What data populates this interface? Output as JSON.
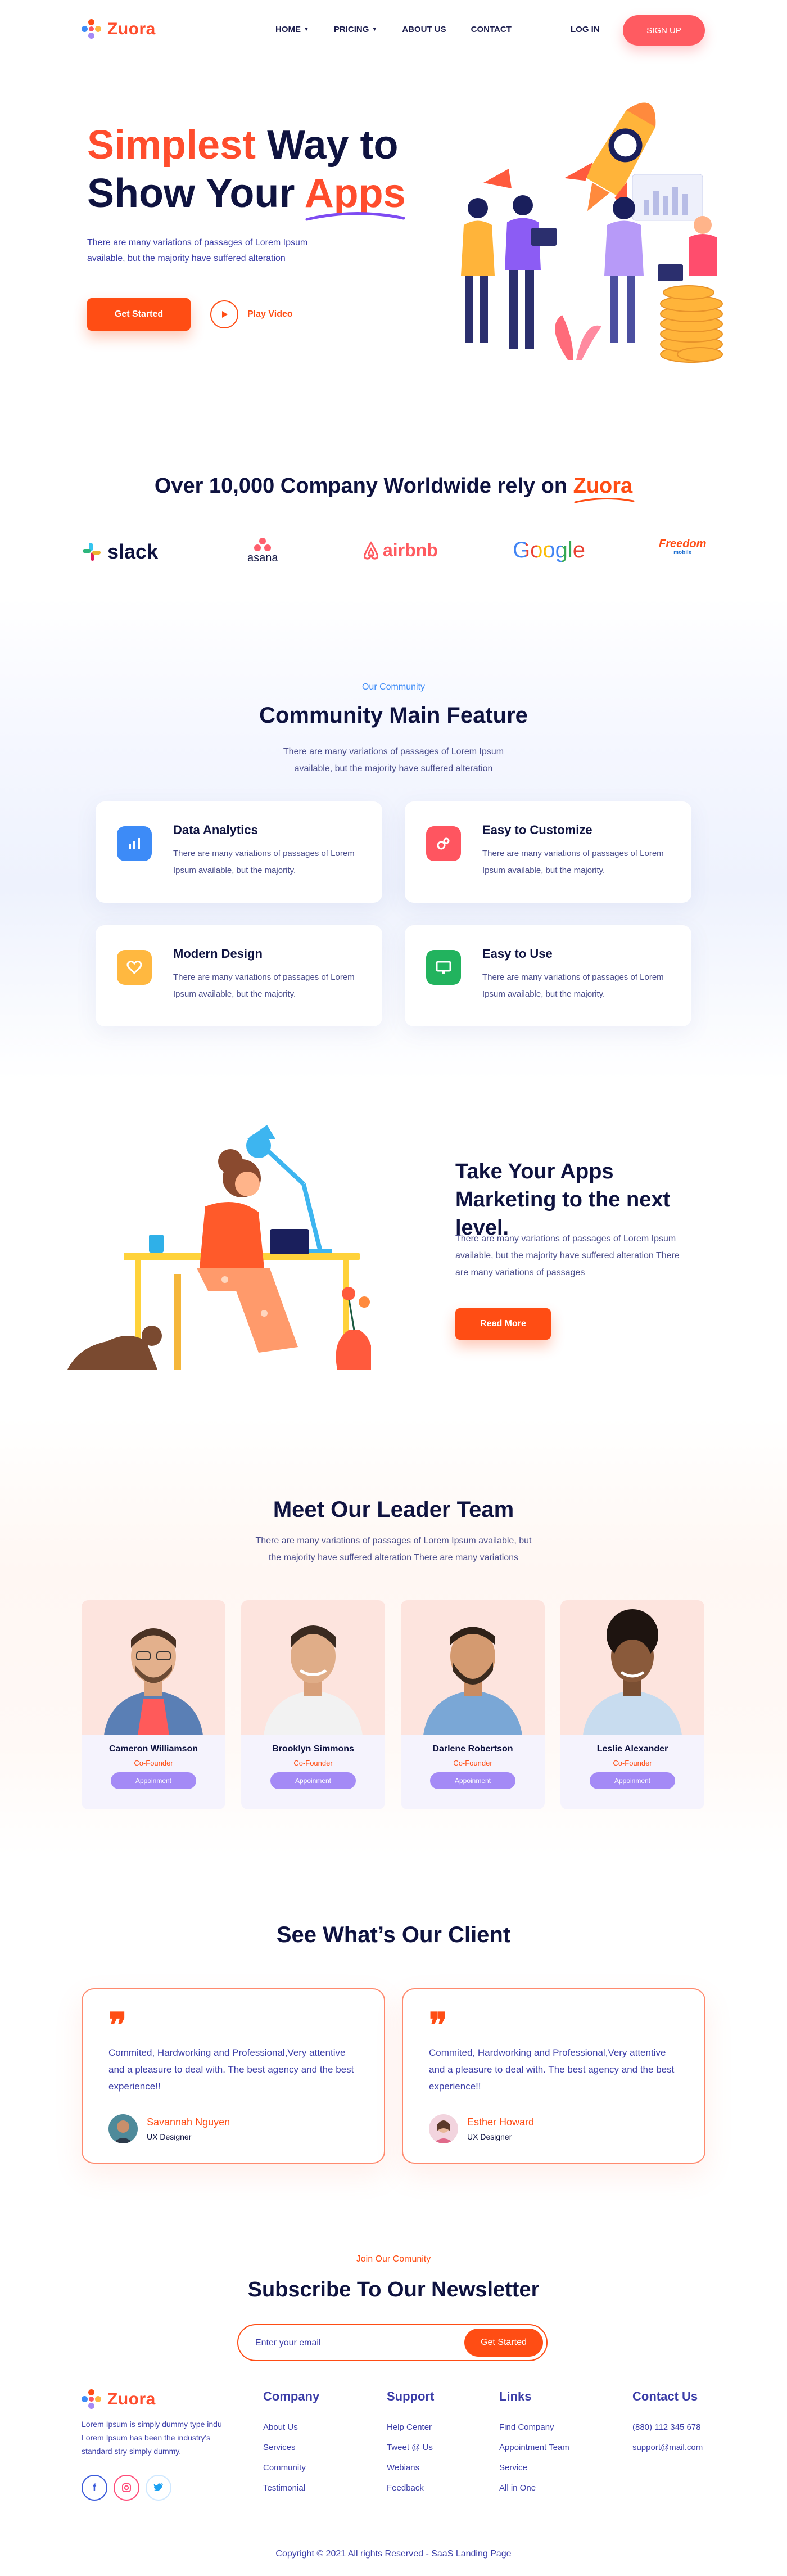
{
  "brand": {
    "name": "Zuora",
    "accent": "#ff4d14",
    "navy": "#0f1340"
  },
  "nav": {
    "items": [
      {
        "label": "HOME",
        "has_dropdown": true
      },
      {
        "label": "PRICING",
        "has_dropdown": true
      },
      {
        "label": "ABOUT US",
        "has_dropdown": false
      },
      {
        "label": "CONTACT",
        "has_dropdown": false
      }
    ],
    "login": "LOG IN",
    "signup": "SIGN UP"
  },
  "hero": {
    "title_accent_1": "Simplest",
    "title_part_1": " Way to",
    "title_part_2": "Show Your ",
    "title_accent_2": "Apps",
    "description": "There are many variations of passages of Lorem Ipsum available, but the majority have suffered alteration",
    "cta_primary": "Get Started",
    "cta_video": "Play Video"
  },
  "trust": {
    "title_prefix": "Over 10,000 Company Worldwide rely on ",
    "title_brand": "Zuora",
    "logos": [
      "slack",
      "asana",
      "airbnb",
      "Google",
      "Freedom"
    ],
    "freedom_sub": "mobile"
  },
  "features": {
    "eyebrow": "Our Community",
    "title": "Community Main Feature",
    "subtitle": "There are many variations of passages of Lorem Ipsum available, but the majority have suffered alteration",
    "items": [
      {
        "title": "Data Analytics",
        "desc": "There are many variations of passages of Lorem Ipsum available, but the majority.",
        "icon": "chart-icon",
        "color": "#3d8bf7"
      },
      {
        "title": "Easy to Customize",
        "desc": "There are many variations of passages of Lorem Ipsum available, but the majority.",
        "icon": "gears-icon",
        "color": "#ff5560"
      },
      {
        "title": "Modern Design",
        "desc": "There are many variations of passages of Lorem Ipsum available, but the majority.",
        "icon": "heart-icon",
        "color": "#ffb840"
      },
      {
        "title": "Easy to Use",
        "desc": "There are many variations of passages of Lorem Ipsum available, but the majority.",
        "icon": "monitor-icon",
        "color": "#22b35e"
      }
    ]
  },
  "marketing": {
    "title": "Take Your Apps Marketing to the next level.",
    "description": "There are many variations of passages of Lorem Ipsum available, but the majority have suffered alteration There are many variations of passages",
    "cta": "Read More"
  },
  "team": {
    "title": "Meet Our Leader Team",
    "subtitle": "There are many variations of passages of Lorem Ipsum available, but the majority have suffered alteration There are many variations",
    "members": [
      {
        "name": "Cameron Williamson",
        "role": "Co-Founder",
        "button": "Appoinment"
      },
      {
        "name": "Brooklyn Simmons",
        "role": "Co-Founder",
        "button": "Appoinment"
      },
      {
        "name": "Darlene Robertson",
        "role": "Co-Founder",
        "button": "Appoinment"
      },
      {
        "name": "Leslie Alexander",
        "role": "Co-Founder",
        "button": "Appoinment"
      }
    ]
  },
  "clients": {
    "title": "See What’s Our Client",
    "testimonials": [
      {
        "text": "Commited, Hardworking and Professional,Very attentive and a pleasure to deal with. The best agency and the best experience!!",
        "name": "Savannah Nguyen",
        "role": "UX Designer"
      },
      {
        "text": "Commited, Hardworking and Professional,Very attentive and a pleasure to deal with. The best agency and the best experience!!",
        "name": "Esther Howard",
        "role": "UX Designer"
      }
    ]
  },
  "newsletter": {
    "eyebrow": "Join Our Comunity",
    "title": "Subscribe To Our Newsletter",
    "placeholder": "Enter your email",
    "button": "Get Started"
  },
  "footer": {
    "about": "Lorem Ipsum is simply dummy type indu Lorem Ipsum has been the industry's standard stry simply dummy.",
    "columns": [
      {
        "title": "Company",
        "links": [
          "About Us",
          "Services",
          "Community",
          "Testimonial"
        ]
      },
      {
        "title": "Support",
        "links": [
          "Help Center",
          "Tweet @ Us",
          "Webians",
          "Feedback"
        ]
      },
      {
        "title": "Links",
        "links": [
          "Find Company",
          "Appointment Team",
          "Service",
          "All in One"
        ]
      },
      {
        "title": "Contact Us",
        "links": [
          "(880) 112 345 678",
          "support@mail.com"
        ]
      }
    ],
    "social": [
      "facebook-icon",
      "instagram-icon",
      "twitter-icon"
    ],
    "copyright": "Copyright © 2021 All rights Reserved - SaaS Landing Page"
  }
}
